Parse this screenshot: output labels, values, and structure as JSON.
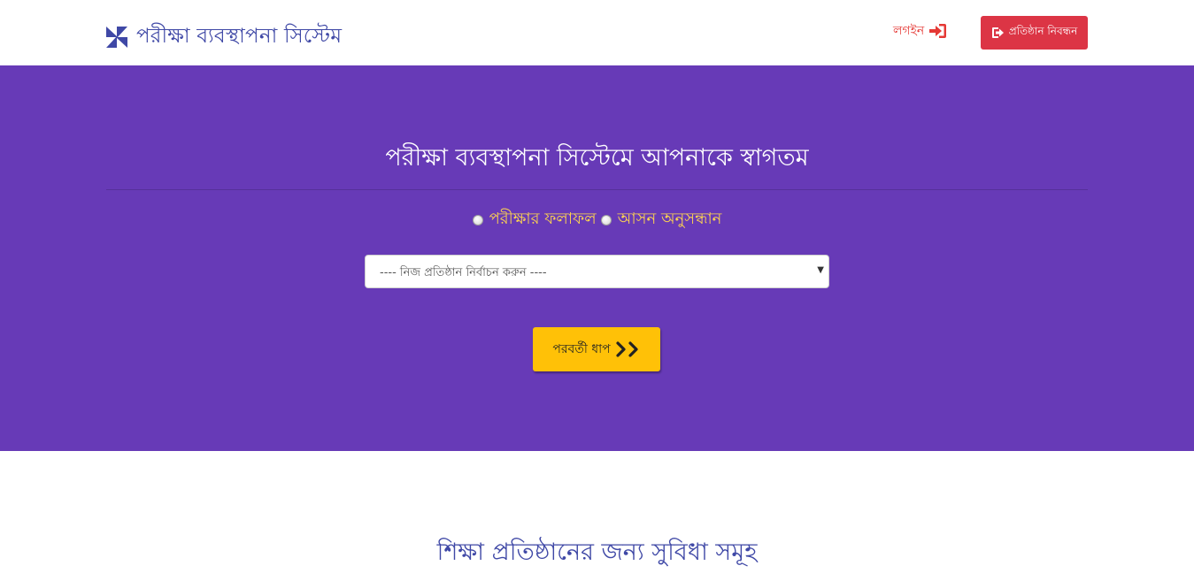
{
  "header": {
    "brand_name": "পরীক্ষা ব্যবস্থাপনা সিস্টেম",
    "brand_icon": "pinwheel-logo",
    "login_label": "লগইন",
    "login_icon": "sign-in-icon",
    "register_label": "প্রতিষ্ঠান নিবন্ধন",
    "register_icon": "sign-out-icon"
  },
  "hero": {
    "title": "পরীক্ষা ব্যবস্থাপনা সিস্টেমে আপনাকে স্বাগতম",
    "radio_options": [
      {
        "label": "পরীক্ষার ফলাফল",
        "checked": false
      },
      {
        "label": "আসন অনুসন্ধান",
        "checked": false
      }
    ],
    "select": {
      "selected": "---- নিজ প্রতিষ্ঠান নির্বাচন করুন ----"
    },
    "next_button_label": "পরবর্তী ধাপ",
    "next_icon": "double-chevron-right-icon"
  },
  "features": {
    "title": "শিক্ষা প্রতিষ্ঠানের জন্য সুবিধা সমূহ"
  },
  "colors": {
    "brand_blue": "#3f48a6",
    "hero_purple": "#673ab7",
    "danger_red": "#dc3545",
    "login_red": "#e53935",
    "accent_yellow": "#ffc107",
    "radio_label_yellow": "#ffd54f"
  }
}
